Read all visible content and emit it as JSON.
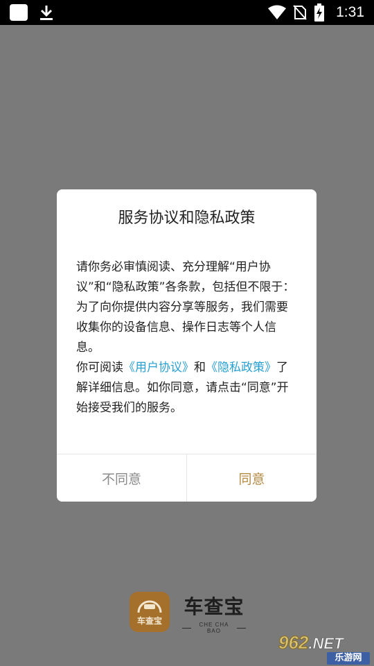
{
  "status_bar": {
    "time": "1:31",
    "icons": [
      "app-notification-icon",
      "download-icon",
      "wifi-icon",
      "no-sim-icon",
      "battery-charging-icon"
    ]
  },
  "dialog": {
    "title": "服务协议和隐私政策",
    "body_intro": "请你务必审慎阅读、充分理解“用户协议”和“隐私政策”各条款，包括但不限于：为了向你提供内容分享等服务，我们需要收集你的设备信息、操作日志等个人信息。",
    "body_read_prefix": "你可阅读",
    "link_user_agreement": "《用户协议》",
    "body_and": "和",
    "link_privacy_policy": "《隐私政策》",
    "body_read_suffix": "了解详细信息。如你同意，请点击“同意”开始接受我们的服务。",
    "disagree_label": "不同意",
    "agree_label": "同意",
    "link_color": "#27a0d4",
    "agree_color": "#b58a43"
  },
  "splash": {
    "logo_text": "车查宝",
    "brand_name": "车查宝",
    "brand_subtitle": "CHE CHA BAO",
    "logo_color": "#a5702c"
  },
  "watermark": {
    "top_number": "962",
    "top_suffix": ".NET",
    "bottom_text": "乐游网"
  }
}
